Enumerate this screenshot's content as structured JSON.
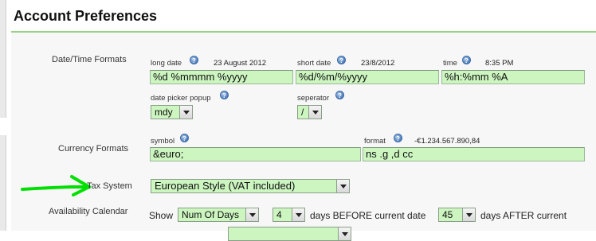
{
  "page": {
    "title": "Account Preferences"
  },
  "datetime": {
    "label": "Date/Time Formats",
    "long_date": {
      "label": "long date",
      "example": "23 August 2012",
      "value": "%d %mmmm %yyyy"
    },
    "short_date": {
      "label": "short date",
      "example": "23/8/2012",
      "value": "%d/%m/%yyyy"
    },
    "time": {
      "label": "time",
      "example": "8:35 PM",
      "value": "%h:%mm %A"
    },
    "date_picker_popup": {
      "label": "date picker popup",
      "value": "mdy"
    },
    "separator": {
      "label": "seperator",
      "value": "/"
    }
  },
  "currency": {
    "label": "Currency Formats",
    "symbol": {
      "label": "symbol",
      "value": "&euro;"
    },
    "format": {
      "label": "format",
      "example": "-€1.234.567.890,84",
      "value": "ns .g ,d cc"
    }
  },
  "tax": {
    "label": "Tax System",
    "value": "European Style (VAT included)",
    "annotation_arrow_color": "#00e000"
  },
  "availability": {
    "label": "Availability Calendar",
    "show_label": "Show",
    "mode_value": "Num Of Days",
    "before_value": "4",
    "before_label": "days BEFORE current date",
    "after_value": "45",
    "after_label": "days AFTER current"
  },
  "icons": {
    "help": "help-icon"
  },
  "colors": {
    "field_bg": "#ccf5c0",
    "accent_rule": "#9bd187",
    "panel_bg": "#f7f7f7"
  }
}
